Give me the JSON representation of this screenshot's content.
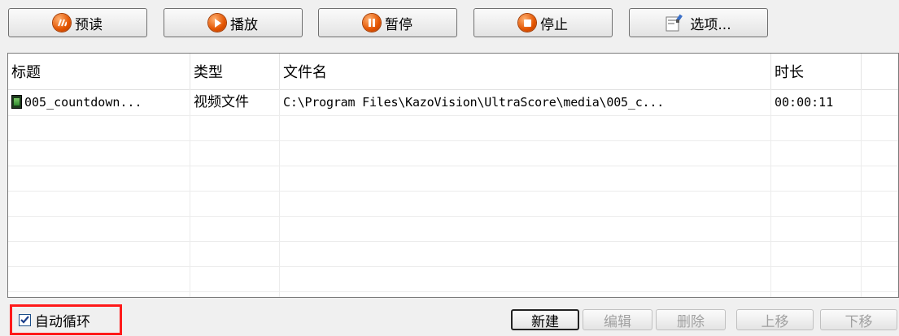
{
  "toolbar": {
    "preread_label": "预读",
    "play_label": "播放",
    "pause_label": "暂停",
    "stop_label": "停止",
    "options_label": "选项..."
  },
  "list": {
    "columns": [
      "标题",
      "类型",
      "文件名",
      "时长"
    ],
    "rows": [
      {
        "title": "005_countdown...",
        "type": "视频文件",
        "filename": "C:\\Program Files\\KazoVision\\UltraScore\\media\\005_c...",
        "duration": "00:00:11"
      }
    ]
  },
  "bottom": {
    "auto_loop_label": "自动循环",
    "auto_loop_checked": true,
    "new_label": "新建",
    "edit_label": "编辑",
    "delete_label": "删除",
    "move_up_label": "上移",
    "move_down_label": "下移"
  },
  "colors": {
    "icon_orange": "#e35400",
    "highlight_red": "#ff1a1a"
  }
}
